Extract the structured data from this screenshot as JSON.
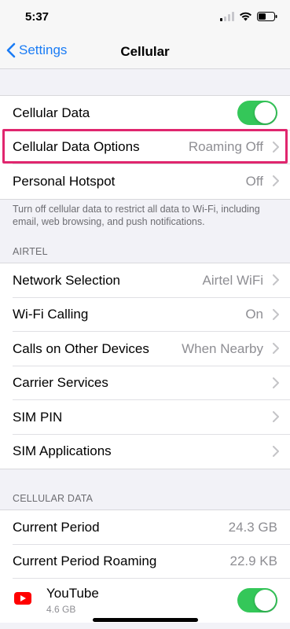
{
  "status": {
    "time": "5:37"
  },
  "nav": {
    "back_label": "Settings",
    "title": "Cellular"
  },
  "top_group": {
    "cellular_data": {
      "label": "Cellular Data",
      "toggle_on": true
    },
    "cellular_data_options": {
      "label": "Cellular Data Options",
      "value": "Roaming Off"
    },
    "personal_hotspot": {
      "label": "Personal Hotspot",
      "value": "Off"
    }
  },
  "footer_note": "Turn off cellular data to restrict all data to Wi-Fi, including email, web browsing, and push notifications.",
  "carrier_section": {
    "header": "AIRTEL",
    "rows": [
      {
        "label": "Network Selection",
        "value": "Airtel WiFi"
      },
      {
        "label": "Wi-Fi Calling",
        "value": "On"
      },
      {
        "label": "Calls on Other Devices",
        "value": "When Nearby"
      },
      {
        "label": "Carrier Services",
        "value": ""
      },
      {
        "label": "SIM PIN",
        "value": ""
      },
      {
        "label": "SIM Applications",
        "value": ""
      }
    ]
  },
  "usage_section": {
    "header": "CELLULAR DATA",
    "current_period": {
      "label": "Current Period",
      "value": "24.3 GB"
    },
    "current_period_roaming": {
      "label": "Current Period Roaming",
      "value": "22.9 KB"
    },
    "apps": [
      {
        "name": "YouTube",
        "size": "4.6 GB",
        "toggle_on": true,
        "icon": "youtube-icon",
        "icon_color": "#ff0000"
      }
    ]
  },
  "colors": {
    "accent": "#1a7cf5",
    "toggle_on": "#34c759",
    "highlight": "#e0266e"
  }
}
